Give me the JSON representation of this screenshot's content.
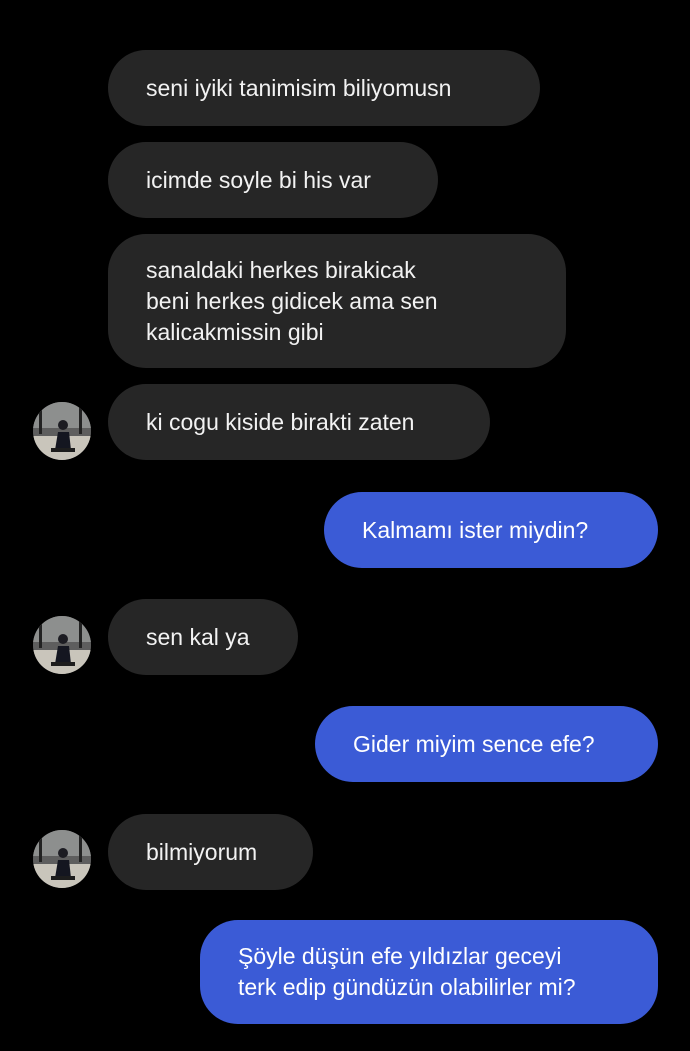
{
  "messages": [
    {
      "side": "incoming",
      "text": "seni iyiki tanimisim biliyomusn"
    },
    {
      "side": "incoming",
      "text": "icimde soyle bi his var"
    },
    {
      "side": "incoming",
      "lines": [
        "sanaldaki herkes birakicak",
        "beni herkes gidicek ama sen",
        "kalicakmissin gibi"
      ]
    },
    {
      "side": "incoming",
      "text": "ki cogu kiside birakti zaten",
      "avatar": "profile-avatar"
    },
    {
      "side": "outgoing",
      "text": "Kalmamı ister miydin?"
    },
    {
      "side": "incoming",
      "text": "sen kal ya",
      "avatar": "profile-avatar"
    },
    {
      "side": "outgoing",
      "text": "Gider miyim sence efe?"
    },
    {
      "side": "incoming",
      "text": "bilmiyorum",
      "avatar": "profile-avatar"
    },
    {
      "side": "outgoing",
      "lines": [
        "Şöyle düşün efe  yıldızlar geceyi",
        "terk edip gündüzün olabilirler mi?"
      ]
    }
  ],
  "colors": {
    "background": "#000000",
    "incoming_bubble": "#262626",
    "outgoing_bubble": "#3b5bd6",
    "text": "#f2f2f2"
  }
}
